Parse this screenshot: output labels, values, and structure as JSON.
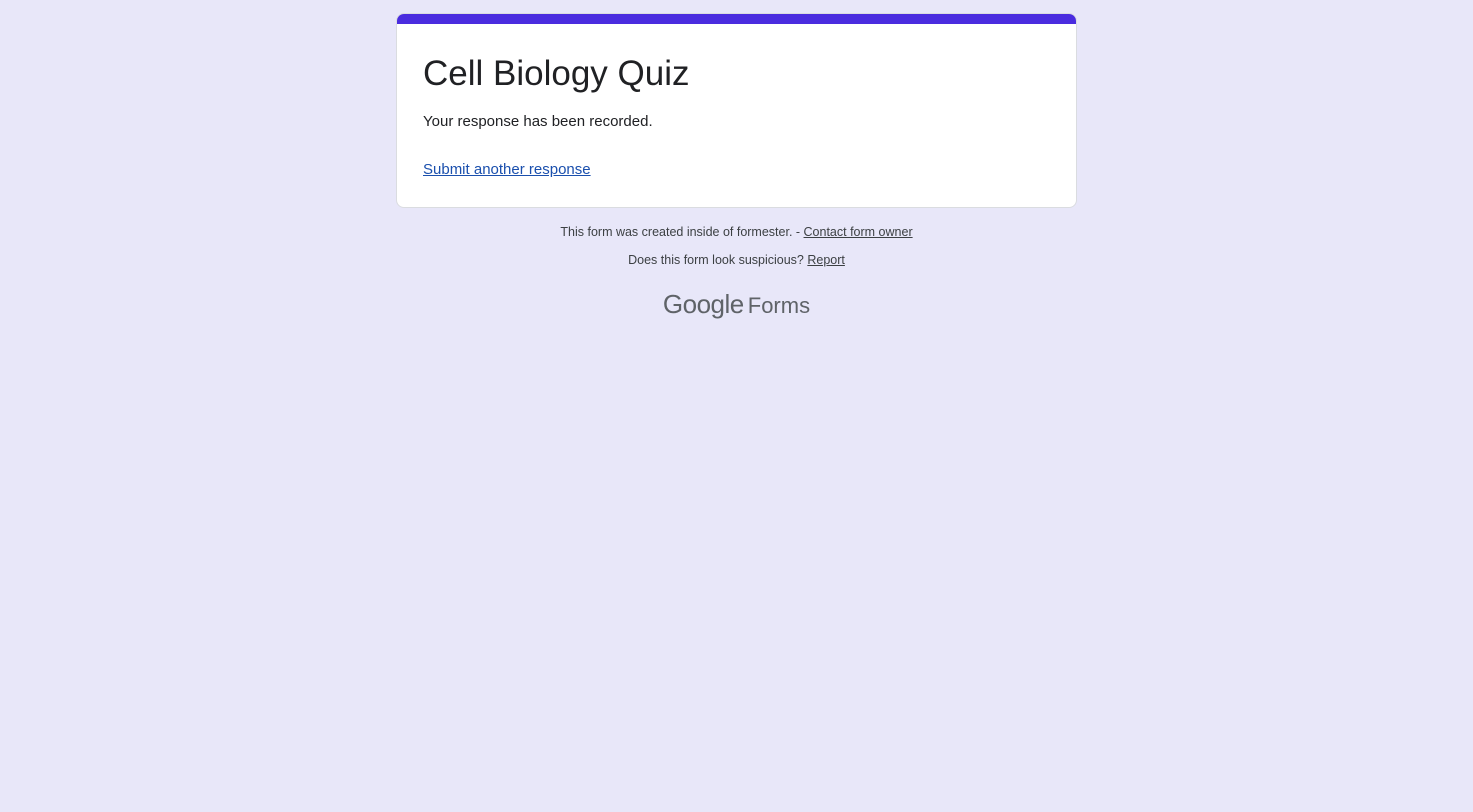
{
  "form": {
    "title": "Cell Biology Quiz",
    "confirmation_message": "Your response has been recorded.",
    "submit_another_label": "Submit another response",
    "accent_color": "#4a2cdf",
    "page_background": "#e8e7f9"
  },
  "footer": {
    "created_text": "This form was created inside of formester. - ",
    "contact_owner_label": "Contact form owner",
    "suspicious_text": "Does this form look suspicious? ",
    "report_label": "Report"
  },
  "brand": {
    "google_text": "Google",
    "forms_text": "Forms"
  }
}
